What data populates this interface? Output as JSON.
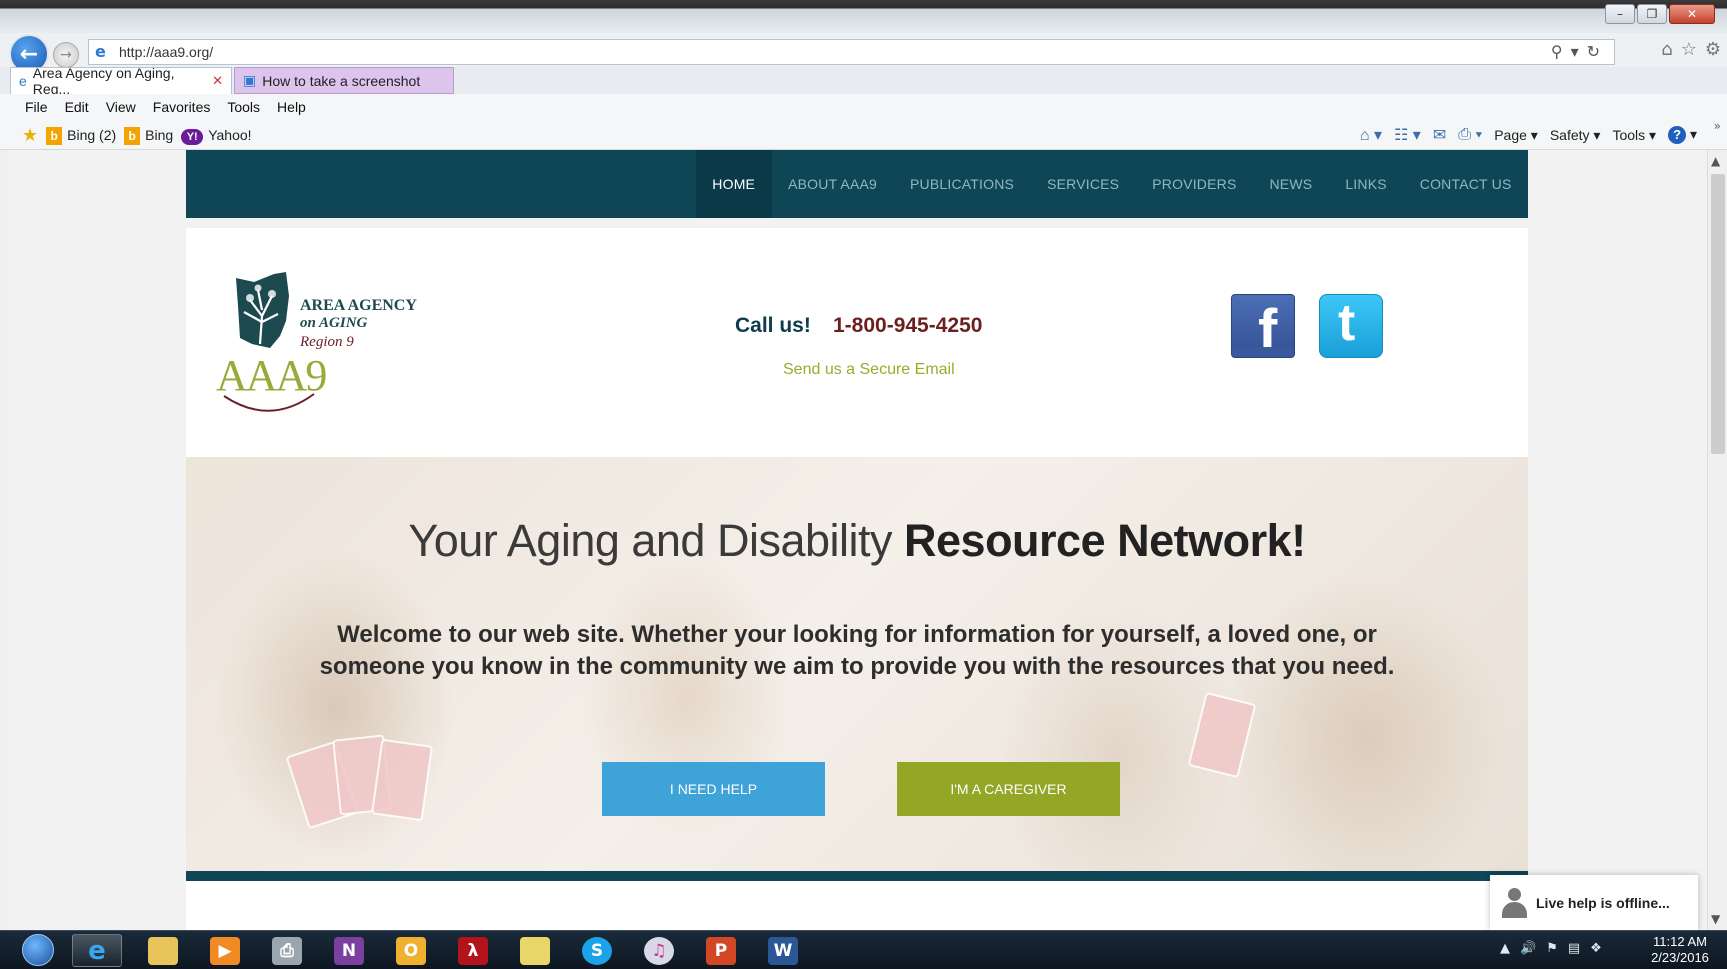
{
  "browser": {
    "url": "http://aaa9.org/",
    "tabs": [
      {
        "label": "Area Agency on Aging, Reg...",
        "active": true
      },
      {
        "label": "How to take a screenshot",
        "active": false
      }
    ],
    "menu": [
      "File",
      "Edit",
      "View",
      "Favorites",
      "Tools",
      "Help"
    ],
    "favorites": [
      {
        "label": "Bing (2)",
        "icon": "bing-icon"
      },
      {
        "label": "Bing",
        "icon": "bing-icon"
      },
      {
        "label": "Yahoo!",
        "icon": "yahoo-icon"
      }
    ],
    "command_bar": {
      "page": "Page",
      "safety": "Safety",
      "tools": "Tools"
    }
  },
  "site": {
    "nav": [
      {
        "label": "HOME",
        "active": true
      },
      {
        "label": "ABOUT AAA9"
      },
      {
        "label": "PUBLICATIONS"
      },
      {
        "label": "SERVICES"
      },
      {
        "label": "PROVIDERS"
      },
      {
        "label": "NEWS"
      },
      {
        "label": "LINKS"
      },
      {
        "label": "CONTACT US"
      }
    ],
    "logo": {
      "line1": "AREA AGENCY",
      "line2": "on AGING",
      "line3": "Region 9",
      "mark": "AAA9"
    },
    "call_label": "Call us!",
    "phone": "1-800-945-4250",
    "secure_email": "Send us a Secure Email",
    "hero": {
      "title_light": "Your Aging and Disability ",
      "title_bold": "Resource Network!",
      "welcome": "Welcome to our web site. Whether your looking for information for yourself, a loved one, or someone you know in the community we aim to provide you with the resources that you need.",
      "btn_help": "I NEED HELP",
      "btn_caregiver": "I'M A CAREGIVER"
    },
    "live_help": "Live help is offline..."
  },
  "taskbar": {
    "time": "11:12 AM",
    "date": "2/23/2016"
  },
  "colors": {
    "nav_bg": "#0f4656",
    "help_button": "#3ea3d8",
    "caregiver_button": "#93a625",
    "secure_link": "#9aac2c"
  }
}
